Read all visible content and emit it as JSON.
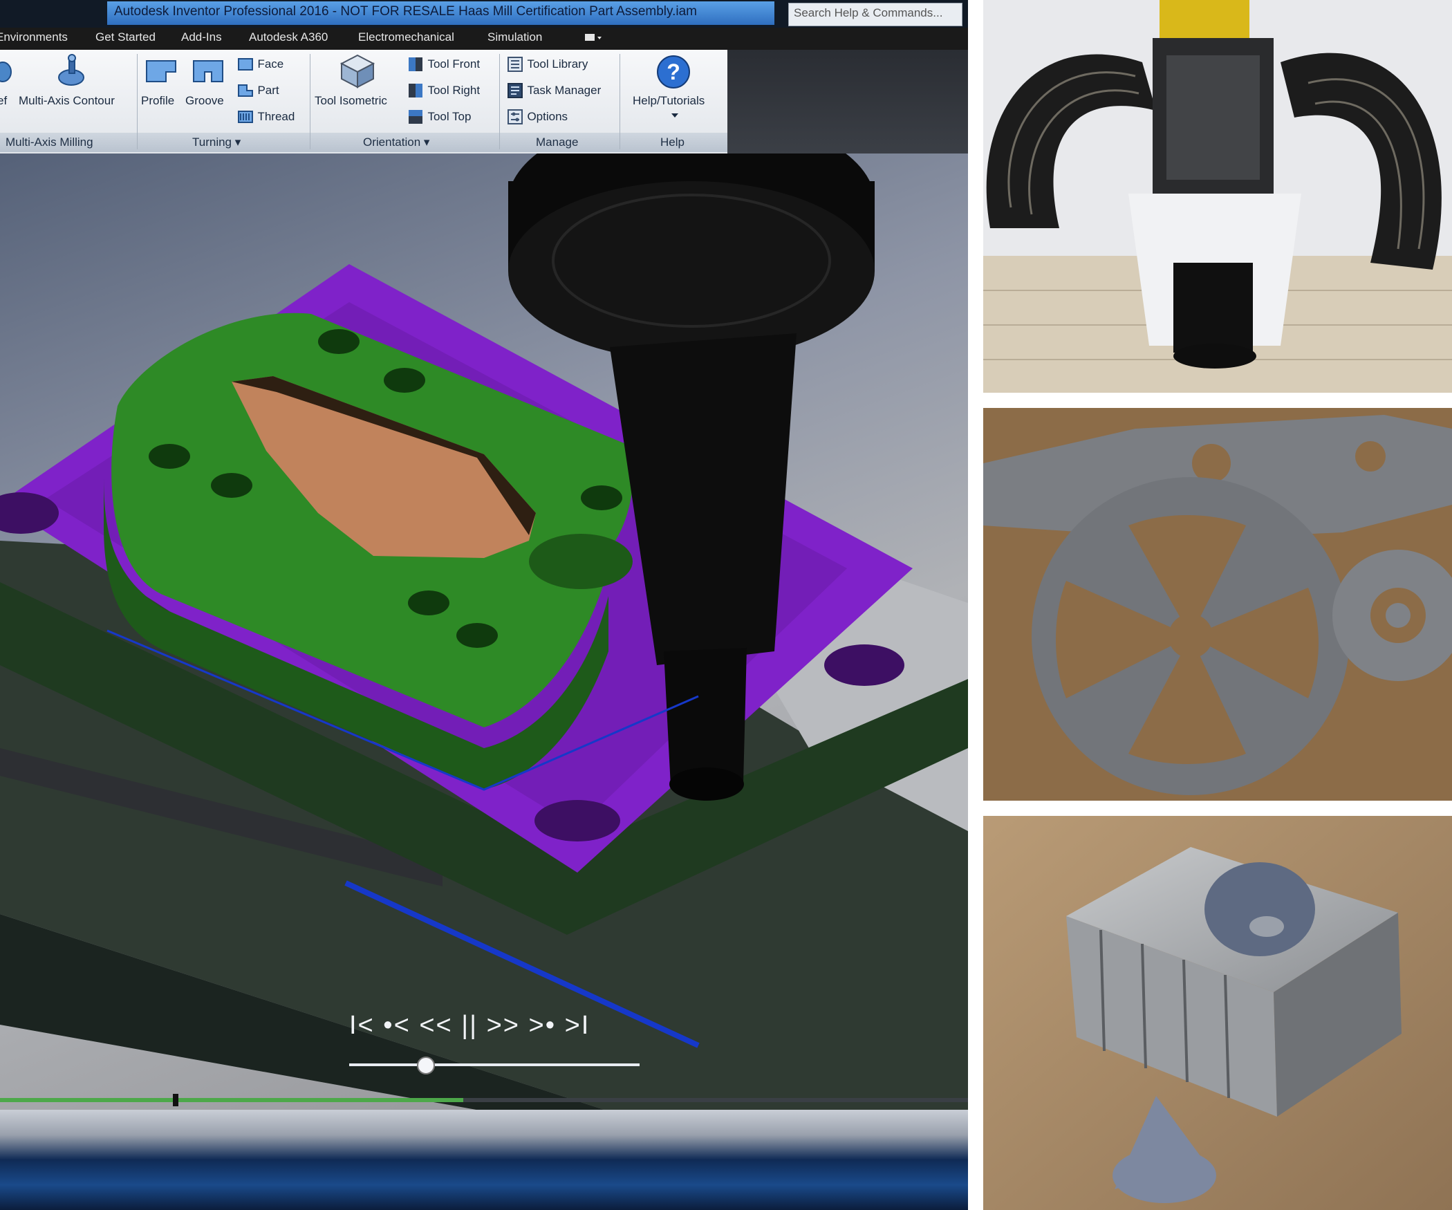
{
  "app": {
    "title": "Autodesk Inventor Professional 2016 - NOT FOR RESALE    Haas Mill Certification Part Assembly.iam",
    "search_placeholder": "Search Help & Commands..."
  },
  "tabs": [
    {
      "label": "Environments"
    },
    {
      "label": "Get Started"
    },
    {
      "label": "Add-Ins"
    },
    {
      "label": "Autodesk A360"
    },
    {
      "label": "Electromechanical"
    },
    {
      "label": "Simulation"
    }
  ],
  "ribbon": {
    "multi_axis": {
      "partial_label": "ef",
      "contour_label": "Multi-Axis Contour",
      "group_label": "Multi-Axis Milling"
    },
    "turning": {
      "profile_label": "Profile",
      "groove_label": "Groove",
      "face_label": "Face",
      "part_label": "Part",
      "thread_label": "Thread",
      "group_label": "Turning ▾"
    },
    "orientation": {
      "isometric_label": "Tool Isometric",
      "front_label": "Tool Front",
      "right_label": "Tool Right",
      "top_label": "Tool Top",
      "group_label": "Orientation ▾"
    },
    "manage": {
      "library_label": "Tool Library",
      "task_label": "Task Manager",
      "options_label": "Options",
      "group_label": "Manage"
    },
    "help": {
      "button_label": "Help/Tutorials",
      "group_label": "Help"
    }
  },
  "simulation": {
    "controls_text": "I< •< << || >> >• >I",
    "progress": 0.26
  },
  "colors": {
    "stock": "#7f22c9",
    "part": "#2e8a26",
    "pocket": "#c1835c",
    "tool": "#0a0a0a",
    "ribbon_accent": "#1a5fb4"
  }
}
